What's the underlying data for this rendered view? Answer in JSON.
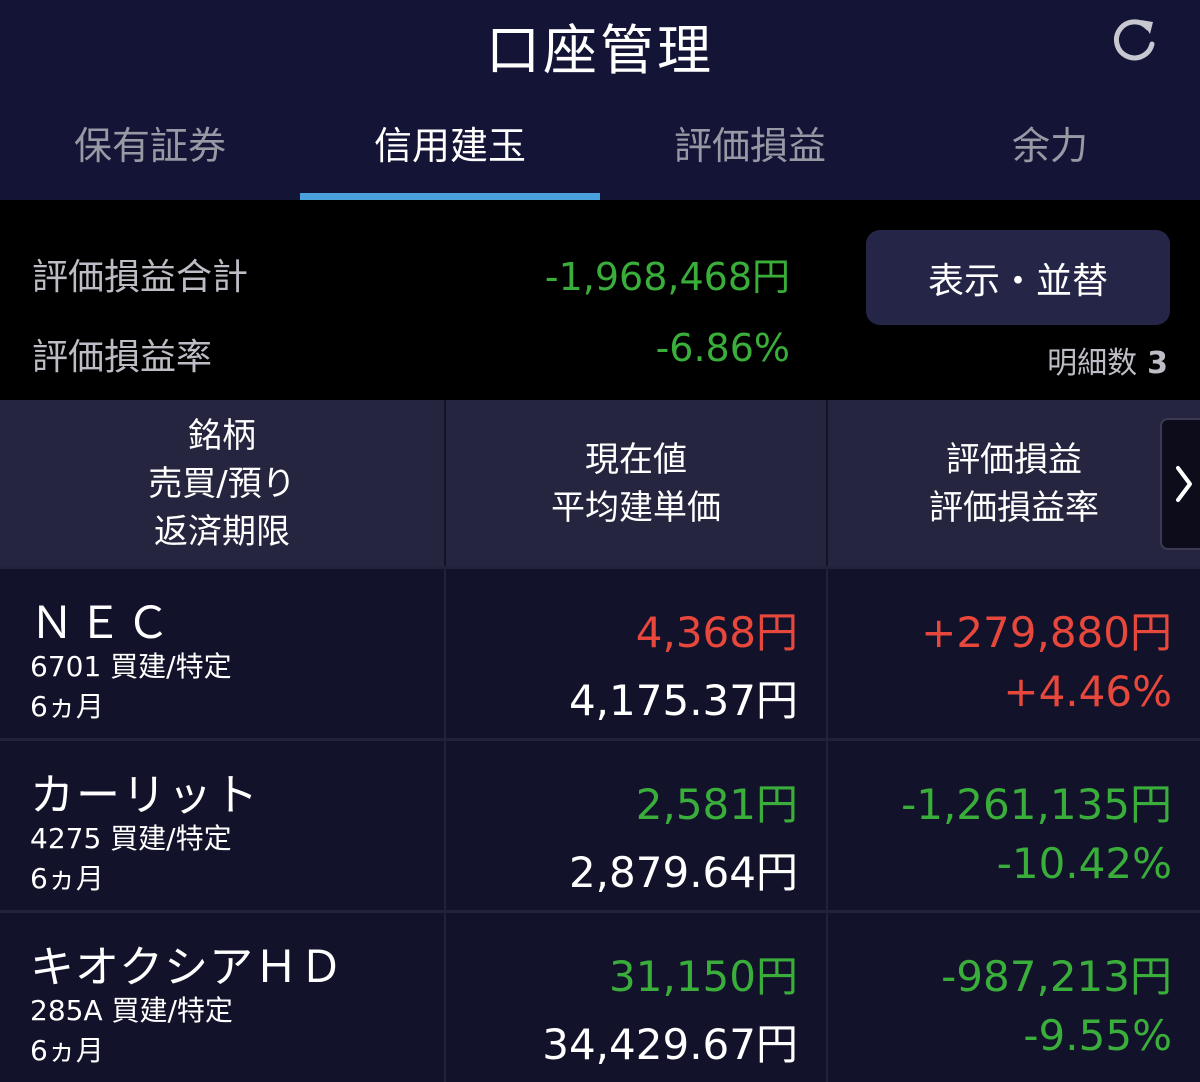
{
  "header": {
    "title": "口座管理",
    "refresh_icon": "refresh-icon"
  },
  "tabs": [
    {
      "label": "保有証券",
      "active": false
    },
    {
      "label": "信用建玉",
      "active": true
    },
    {
      "label": "評価損益",
      "active": false
    },
    {
      "label": "余力",
      "active": false
    }
  ],
  "summary": {
    "total_label": "評価損益合計",
    "total_value": "-1,968,468円",
    "rate_label": "評価損益率",
    "rate_value": "-6.86%",
    "sort_button": "表示・並替",
    "detail_label": "明細数",
    "detail_count": "3",
    "value_color": "#3aae3a"
  },
  "columns": {
    "col1": [
      "銘柄",
      "売買/預り",
      "返済期限"
    ],
    "col2": [
      "現在値",
      "平均建単価"
    ],
    "col3": [
      "評価損益",
      "評価損益率"
    ],
    "scroll_icon": "chevron-right-icon"
  },
  "colors": {
    "gain": "#e8473c",
    "loss": "#3aae3a",
    "accent": "#4aa2dc"
  },
  "rows": [
    {
      "name": "ＮＥＣ",
      "code": "6701 買建/特定",
      "term": "6ヵ月",
      "price": "4,368円",
      "avg_price": "4,175.37円",
      "pl": "+279,880円",
      "pl_rate": "+4.46%",
      "trend": "gain"
    },
    {
      "name": "カーリット",
      "code": "4275 買建/特定",
      "term": "6ヵ月",
      "price": "2,581円",
      "avg_price": "2,879.64円",
      "pl": "-1,261,135円",
      "pl_rate": "-10.42%",
      "trend": "loss"
    },
    {
      "name": "キオクシアＨＤ",
      "code": "285A 買建/特定",
      "term": "6ヵ月",
      "price": "31,150円",
      "avg_price": "34,429.67円",
      "pl": "-987,213円",
      "pl_rate": "-9.55%",
      "trend": "loss"
    }
  ]
}
